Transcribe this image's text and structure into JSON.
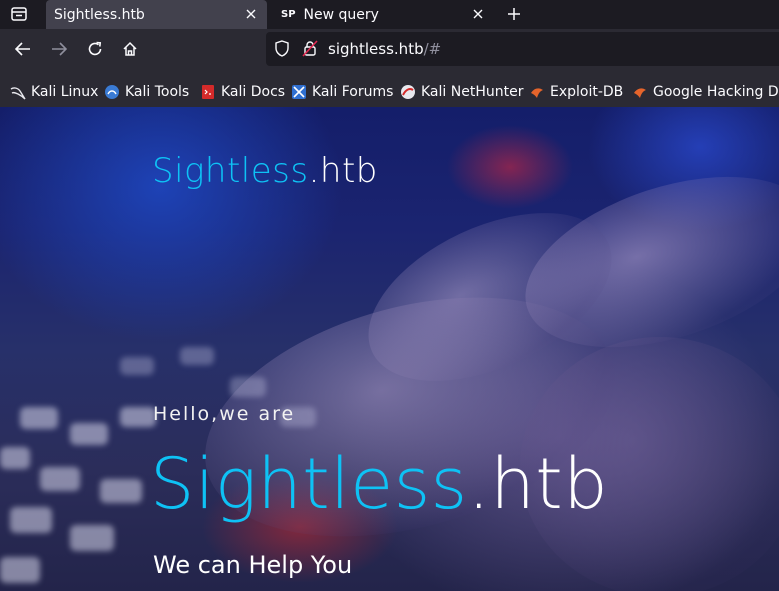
{
  "tabs": [
    {
      "title": "Sightless.htb",
      "active": true,
      "favicon": ""
    },
    {
      "title": "New query",
      "active": false,
      "favicon": "SP"
    }
  ],
  "navbar": {
    "url_host": "sightless.htb",
    "url_path": "/#"
  },
  "bookmarks": [
    {
      "label": "Kali Linux",
      "icon": "kali-dragon-icon"
    },
    {
      "label": "Kali Tools",
      "icon": "kali-tools-icon"
    },
    {
      "label": "Kali Docs",
      "icon": "kali-docs-icon"
    },
    {
      "label": "Kali Forums",
      "icon": "kali-forums-icon"
    },
    {
      "label": "Kali NetHunter",
      "icon": "kali-nethunter-icon"
    },
    {
      "label": "Exploit-DB",
      "icon": "exploit-db-icon"
    },
    {
      "label": "Google Hacking DB",
      "icon": "ghdb-icon"
    }
  ],
  "hero": {
    "logo_part1": "Sightless",
    "logo_part2": ".htb",
    "hello": "Hello,we are",
    "headline_part1": "Sightless",
    "headline_part2": ".htb",
    "tagline": "We can Help You"
  },
  "colors": {
    "accent": "#0ec2f5",
    "toolbar": "#2b2a33",
    "tabstrip": "#1c1b22"
  }
}
